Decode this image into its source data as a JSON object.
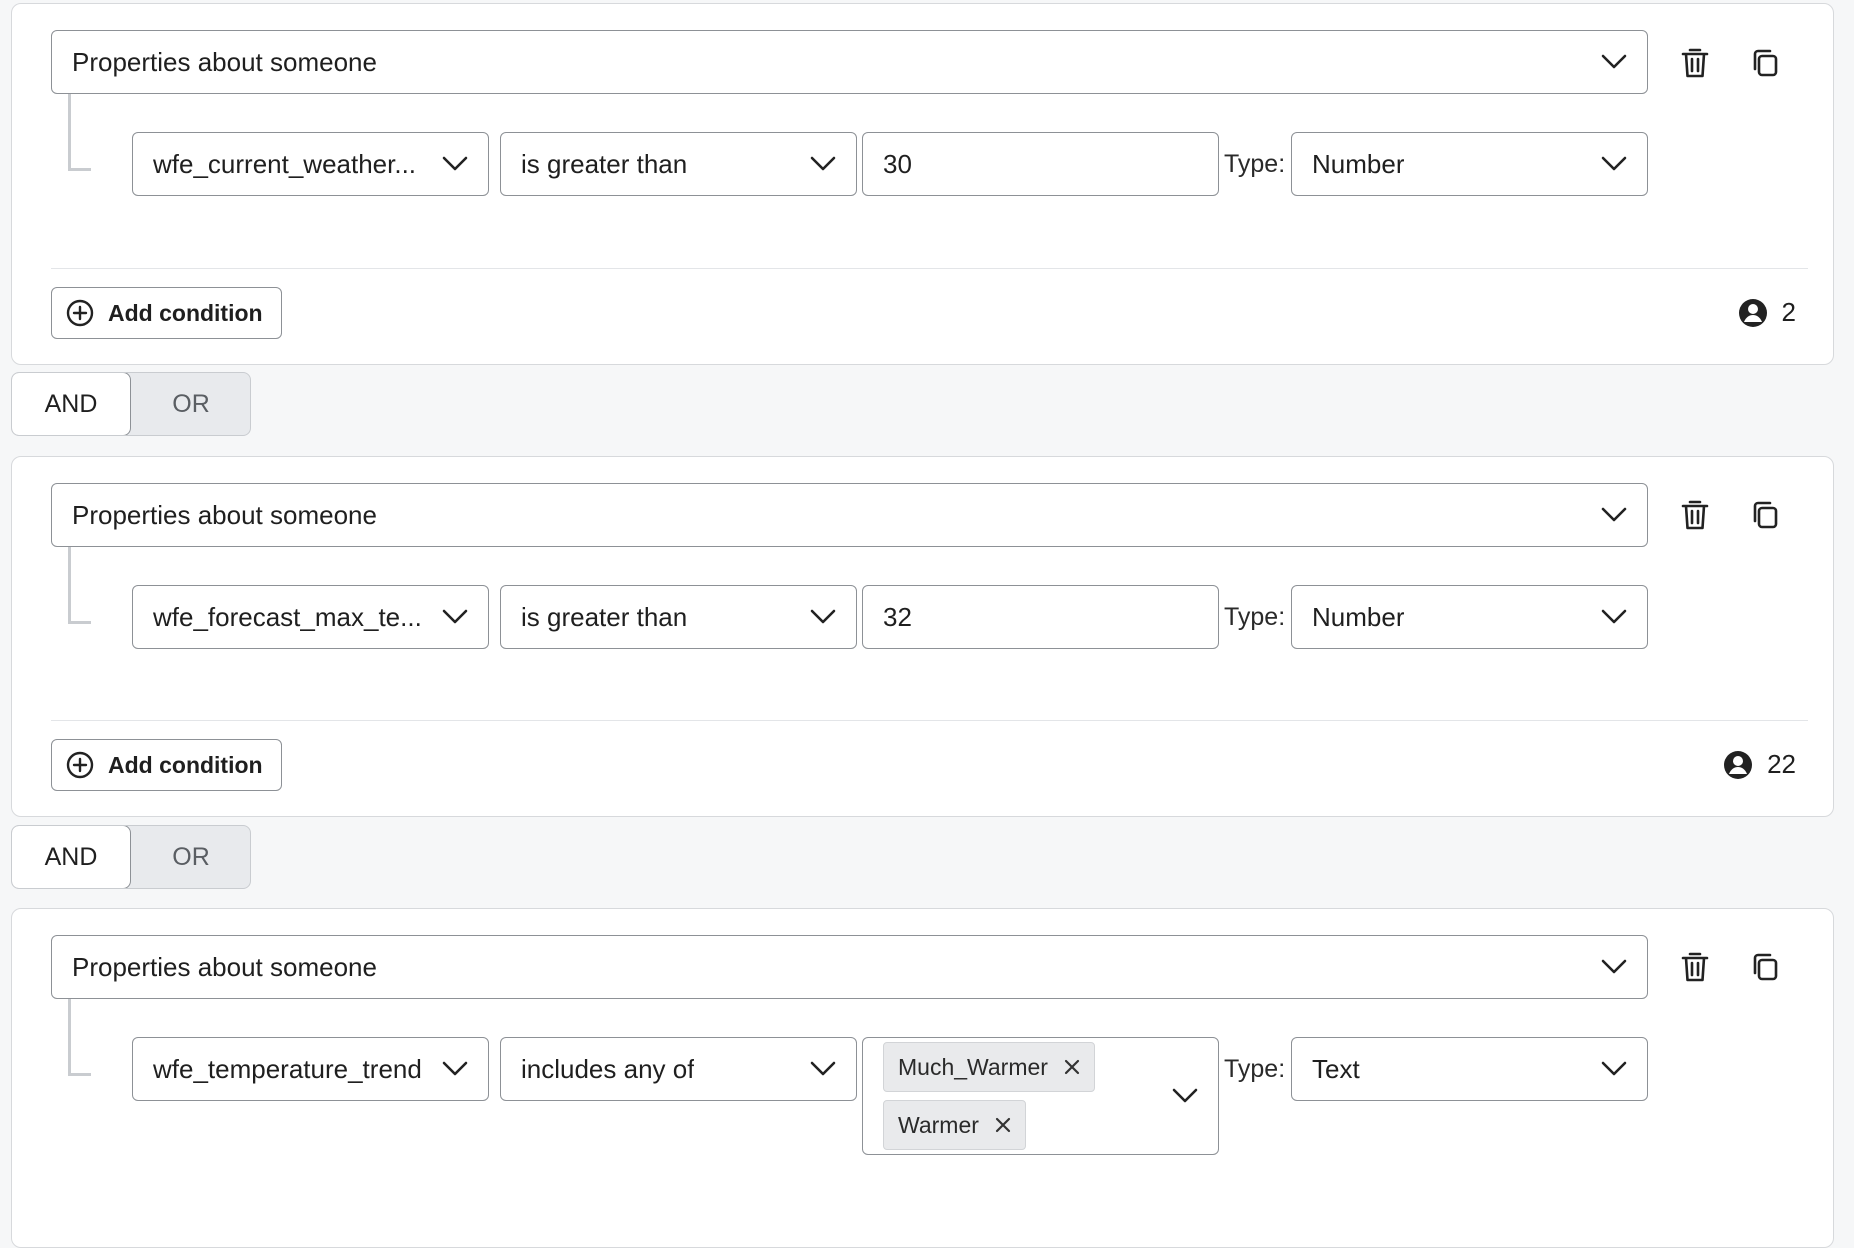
{
  "groups": [
    {
      "category": "Properties about someone",
      "condition": {
        "property": "wfe_current_weather...",
        "operator": "is greater than",
        "value": "30",
        "type_label": "Type:",
        "type": "Number"
      },
      "add_condition_label": "Add condition",
      "count": "2"
    },
    {
      "category": "Properties about someone",
      "condition": {
        "property": "wfe_forecast_max_te...",
        "operator": "is greater than",
        "value": "32",
        "type_label": "Type:",
        "type": "Number"
      },
      "add_condition_label": "Add condition",
      "count": "22"
    },
    {
      "category": "Properties about someone",
      "condition": {
        "property": "wfe_temperature_trend",
        "operator": "includes any of",
        "values": [
          "Much_Warmer",
          "Warmer"
        ],
        "type_label": "Type:",
        "type": "Text"
      }
    }
  ],
  "toggles": [
    {
      "and_label": "AND",
      "or_label": "OR",
      "selected": "AND"
    },
    {
      "and_label": "AND",
      "or_label": "OR",
      "selected": "AND"
    }
  ],
  "icons": [
    "trash-icon",
    "copy-icon",
    "chevron-down-icon",
    "plus-circle-icon",
    "person-circle-icon",
    "close-icon"
  ]
}
